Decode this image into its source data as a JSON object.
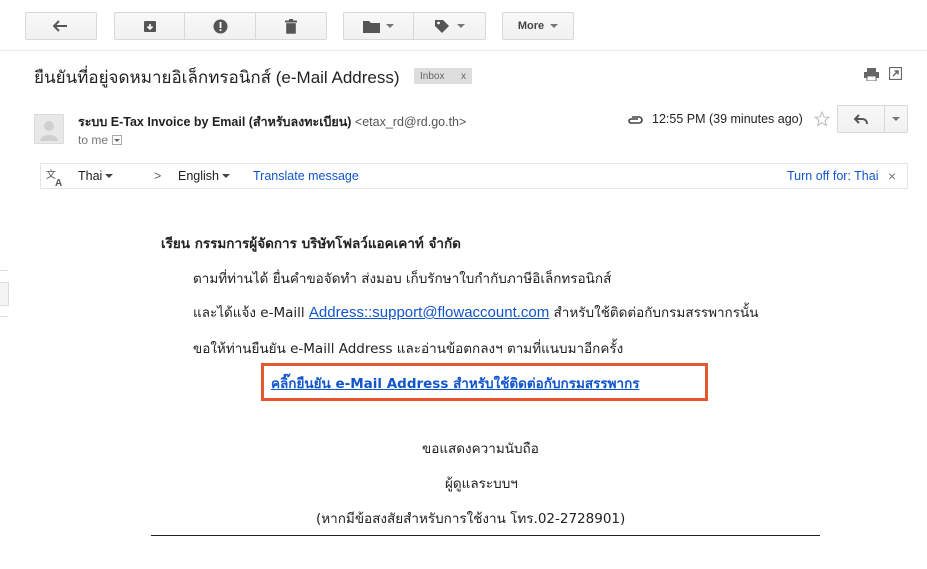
{
  "toolbar": {
    "more_label": "More"
  },
  "message": {
    "subject": "ยืนยันที่อยู่จดหมายอิเล็กทรอนิกส์ (e-Mail Address)",
    "label_chip": "Inbox",
    "label_chip_remove": "x",
    "sender_name": "ระบบ E-Tax Invoice by Email (สำหรับลงทะเบียน)",
    "sender_email": "<etax_rd@rd.go.th>",
    "recipient": "to me",
    "time": "12:55 PM (39 minutes ago)"
  },
  "translate": {
    "source_lang": "Thai",
    "arrow": ">",
    "target_lang": "English",
    "action": "Translate message",
    "turn_off": "Turn off for: Thai",
    "close": "×"
  },
  "body": {
    "greeting": "เรียน  กรรมการผู้จัดการ  บริษัทโฟลว์แอคเคาท์ จำกัด",
    "line1": "ตามที่ท่านได้ ยื่นคำขอจัดทำ ส่งมอบ เก็บรักษาใบกำกับภาษีอิเล็กทรอนิกส์",
    "line2_prefix": "และได้แจ้ง e-Maill ",
    "line2_link": "Address::support@flowaccount.com",
    "line2_suffix": "  สำหรับใช้ติดต่อกับกรมสรรพากรนั้น",
    "line3": "ขอให้ท่านยืนยัน e-Maill Address และอ่านข้อตกลงฯ ตามที่แนบมาอีกครั้ง",
    "cta": "คลิ๊กยืนยัน e-Mail Address สำหรับใช้ติดต่อกับกรมสรรพากร",
    "closing1": "ขอแสดงความนับถือ",
    "closing2": "ผู้ดูแลระบบฯ",
    "closing3": "(หากมีข้อสงสัยสำหรับการใช้งาน โทร.02-2728901)"
  },
  "colors": {
    "link": "#1155cc",
    "highlight_box": "#e4572e"
  }
}
